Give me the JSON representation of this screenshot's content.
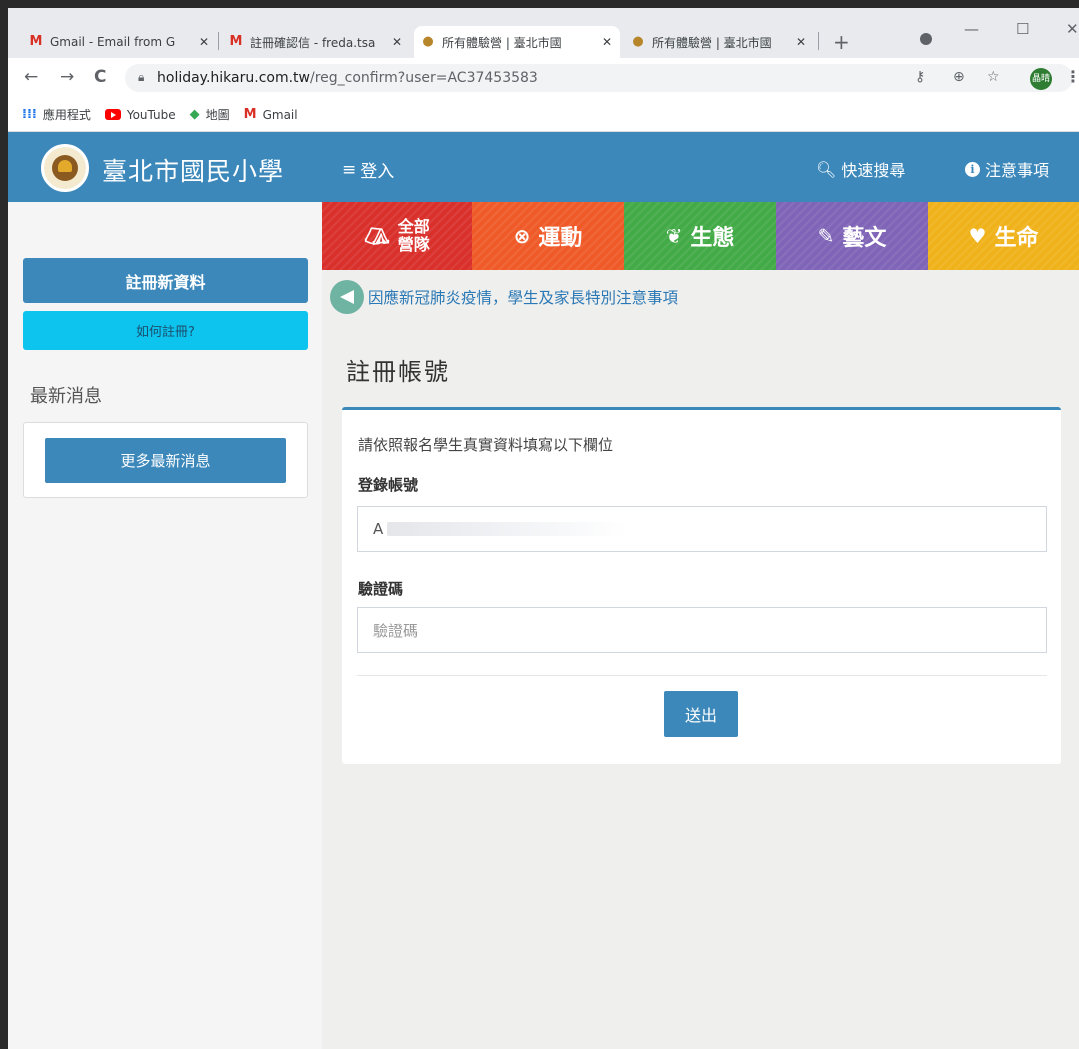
{
  "browser": {
    "tabs": [
      {
        "title": "Gmail - Email from G",
        "icon": "gmail-icon"
      },
      {
        "title": "註冊確認信 - freda.tsa",
        "icon": "gmail-icon"
      },
      {
        "title": "所有體驗營 | 臺北市國",
        "icon": "school-logo-icon",
        "active": true
      },
      {
        "title": "所有體驗營 | 臺北市國",
        "icon": "school-logo-icon"
      }
    ],
    "url_host": "holiday.hikaru.com.tw",
    "url_path": "/reg_confirm?user=AC37453583",
    "profile_initials": "晶晴",
    "bookmarks": [
      {
        "label": "應用程式",
        "icon": "apps-grid-icon"
      },
      {
        "label": "YouTube",
        "icon": "youtube-icon"
      },
      {
        "label": "地圖",
        "icon": "maps-icon"
      },
      {
        "label": "Gmail",
        "icon": "gmail-icon"
      }
    ]
  },
  "site": {
    "title": "臺北市國民小學",
    "menu_login": "登入",
    "quick_search": "快速搜尋",
    "notes": "注意事項",
    "brand_color": "#3c88bb"
  },
  "sidebar": {
    "register_btn": "註冊新資料",
    "howto_btn": "如何註冊?",
    "news_title": "最新消息",
    "more_news_btn": "更多最新消息"
  },
  "categories": [
    {
      "line1": "全部",
      "line2": "營隊",
      "icon": "camp-tents-icon",
      "color": "#d9302b"
    },
    {
      "label": "運動",
      "icon": "basketball-icon",
      "color": "#ef5a28"
    },
    {
      "label": "生態",
      "icon": "leaf-icon",
      "color": "#42aa47"
    },
    {
      "label": "藝文",
      "icon": "palette-icon",
      "color": "#7f64b7"
    },
    {
      "label": "生命",
      "icon": "hands-heart-icon",
      "color": "#f0b21a"
    }
  ],
  "notice_text": "因應新冠肺炎疫情，學生及家長特別注意事項",
  "page_heading": "註冊帳號",
  "form": {
    "intro": "請依照報名學生真實資料填寫以下欄位",
    "account_label": "登錄帳號",
    "account_value": "A",
    "captcha_label": "驗證碼",
    "captcha_placeholder": "驗證碼",
    "submit": "送出"
  }
}
